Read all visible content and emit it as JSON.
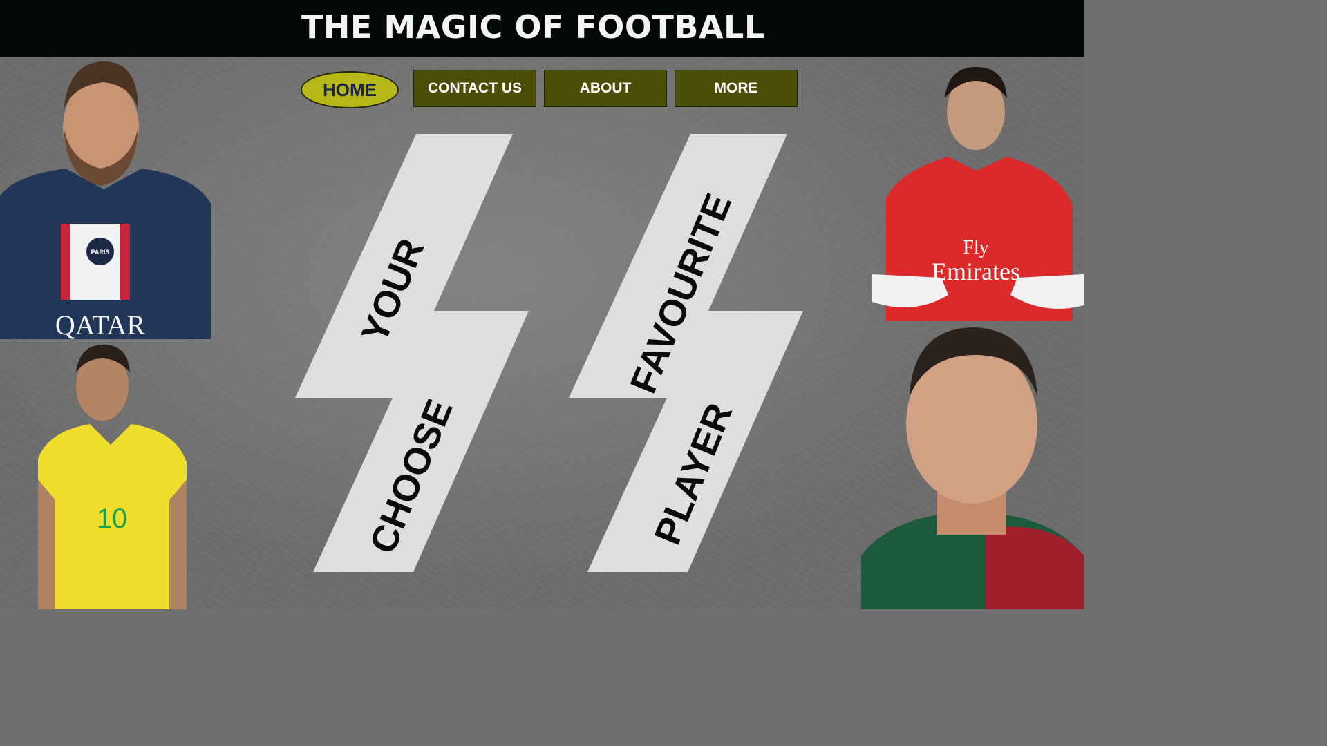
{
  "header": {
    "title": "THE MAGIC OF FOOTBALL"
  },
  "nav": {
    "home": "HOME",
    "contact": "CONTACT US",
    "about": "ABOUT",
    "more": "MORE"
  },
  "hero": {
    "word1": "YOUR",
    "word2": "CHOOSE",
    "word3": "FAVOURITE",
    "word4": "PLAYER"
  },
  "players": [
    {
      "shirt_text": "QATAR",
      "badge": "PARIS"
    },
    {
      "shirt_number": "10"
    },
    {
      "shirt_text_1": "Fly",
      "shirt_text_2": "Emirates"
    },
    {}
  ],
  "colors": {
    "header_bg": "#030707",
    "nav_home_bg": "#b5b816",
    "nav_bg": "#4a4e07",
    "background": "#6c6c6c",
    "bolt": "#e6e6e6"
  }
}
